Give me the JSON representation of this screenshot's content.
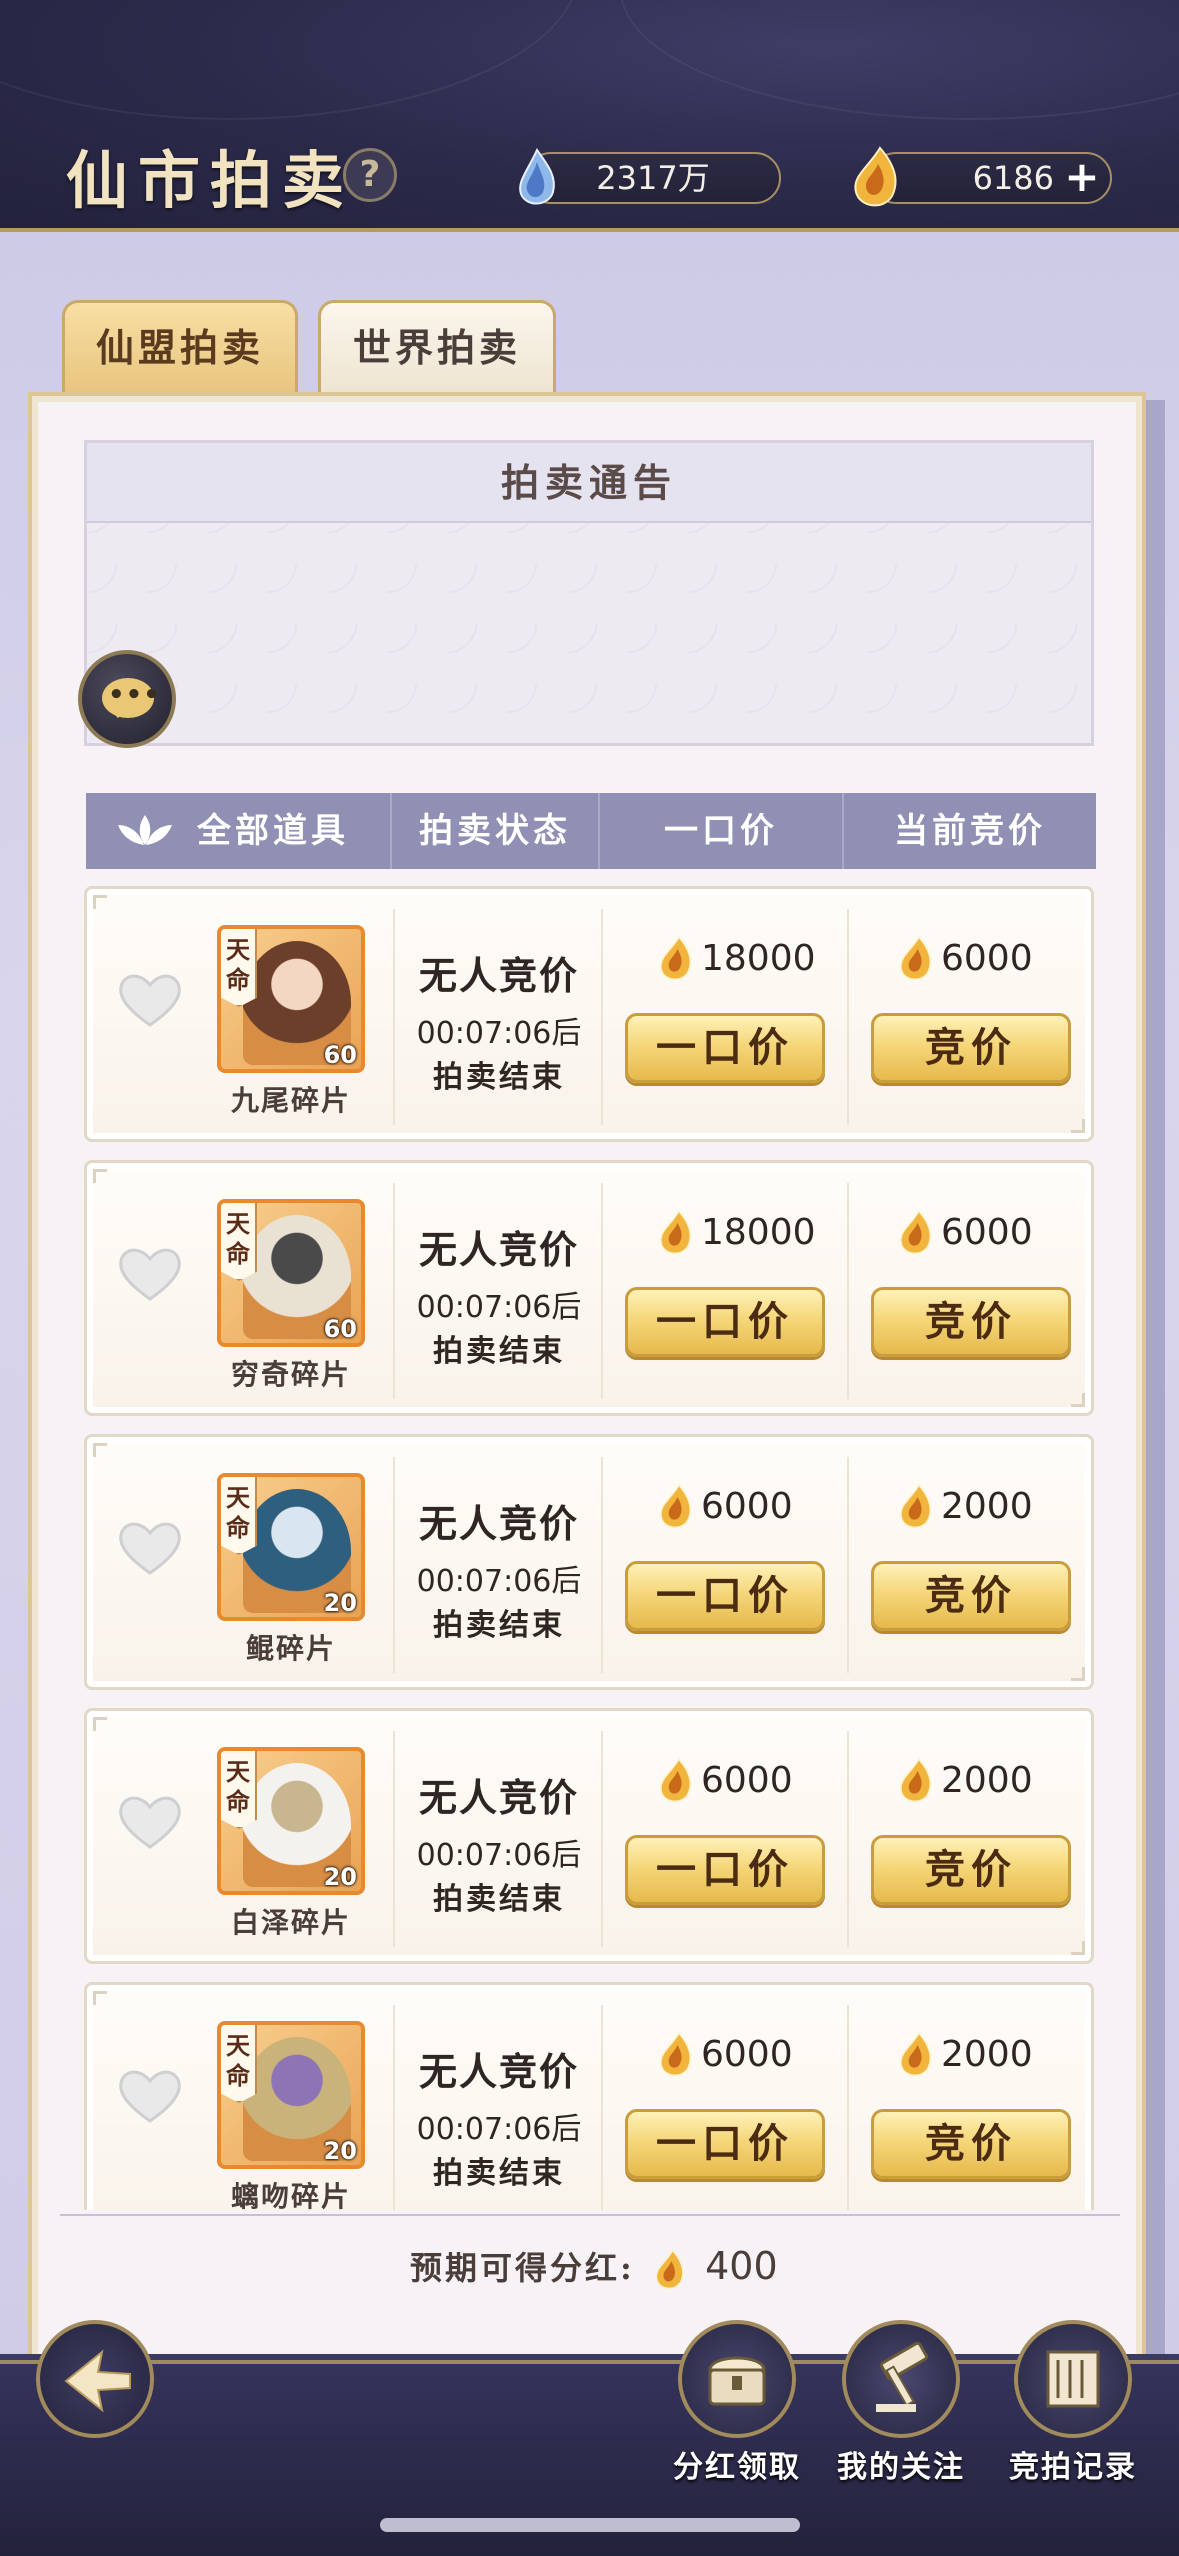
{
  "header": {
    "title": "仙市拍卖",
    "help": "?",
    "currency_gem": "2317万",
    "currency_coin": "6186",
    "plus": "+"
  },
  "tabs": [
    {
      "label": "仙盟拍卖",
      "active": true
    },
    {
      "label": "世界拍卖",
      "active": false
    }
  ],
  "notice": {
    "title": "拍卖通告"
  },
  "columns": {
    "items": "全部道具",
    "status": "拍卖状态",
    "buyout": "一口价",
    "current_bid": "当前竞价"
  },
  "rows": [
    {
      "name": "九尾碎片",
      "badge": "天命",
      "count": "60",
      "status": "无人竞价",
      "time": "00:07:06后",
      "end": "拍卖结束",
      "buyout": "18000",
      "bid": "6000",
      "buyout_btn": "一口价",
      "bid_btn": "竞价"
    },
    {
      "name": "穷奇碎片",
      "badge": "天命",
      "count": "60",
      "status": "无人竞价",
      "time": "00:07:06后",
      "end": "拍卖结束",
      "buyout": "18000",
      "bid": "6000",
      "buyout_btn": "一口价",
      "bid_btn": "竞价"
    },
    {
      "name": "鲲碎片",
      "badge": "天命",
      "count": "20",
      "status": "无人竞价",
      "time": "00:07:06后",
      "end": "拍卖结束",
      "buyout": "6000",
      "bid": "2000",
      "buyout_btn": "一口价",
      "bid_btn": "竞价"
    },
    {
      "name": "白泽碎片",
      "badge": "天命",
      "count": "20",
      "status": "无人竞价",
      "time": "00:07:06后",
      "end": "拍卖结束",
      "buyout": "6000",
      "bid": "2000",
      "buyout_btn": "一口价",
      "bid_btn": "竞价"
    },
    {
      "name": "螭吻碎片",
      "badge": "天命",
      "count": "20",
      "status": "无人竞价",
      "time": "00:07:06后",
      "end": "拍卖结束",
      "buyout": "6000",
      "bid": "2000",
      "buyout_btn": "一口价",
      "bid_btn": "竞价"
    }
  ],
  "dividend": {
    "label": "预期可得分红:",
    "value": "400"
  },
  "footer": {
    "dividend_claim": "分红领取",
    "my_watch": "我的关注",
    "bid_record": "竞拍记录"
  },
  "colors": {
    "header_bg": "#2b2a4a",
    "gold_button": "#f5d77a",
    "column_header": "#8f90b3",
    "item_frame": "#e8892e"
  },
  "icons": {
    "gem": "blue-spirit-gem-icon",
    "coin": "golden-flame-coin-icon",
    "heart": "heart-outline-icon",
    "chat": "chat-bubble-icon",
    "back": "back-arrow-icon"
  }
}
